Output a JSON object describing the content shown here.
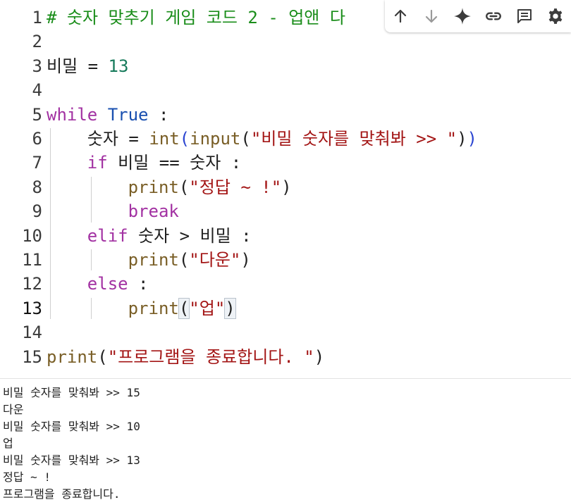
{
  "editor": {
    "active_line": 13,
    "lines": [
      {
        "n": "1",
        "tokens": [
          {
            "t": "# 숫자 맞추기 게임 코드 2 - 업앤 다",
            "c": "comment"
          }
        ]
      },
      {
        "n": "2",
        "tokens": []
      },
      {
        "n": "3",
        "tokens": [
          {
            "t": "비밀 = ",
            "c": "op"
          },
          {
            "t": "13",
            "c": "num"
          }
        ]
      },
      {
        "n": "4",
        "tokens": []
      },
      {
        "n": "5",
        "tokens": [
          {
            "t": "while",
            "c": "kw"
          },
          {
            "t": " ",
            "c": "op"
          },
          {
            "t": "True",
            "c": "bool"
          },
          {
            "t": " :",
            "c": "op"
          }
        ]
      },
      {
        "n": "6",
        "tokens": [
          {
            "t": "    숫자 = ",
            "c": "op"
          },
          {
            "t": "int",
            "c": "fn"
          },
          {
            "t": "(",
            "c": "paren2"
          },
          {
            "t": "input",
            "c": "fn"
          },
          {
            "t": "(",
            "c": "paren"
          },
          {
            "t": "\"비밀 숫자를 맞춰봐 >> \"",
            "c": "str"
          },
          {
            "t": ")",
            "c": "paren"
          },
          {
            "t": ")",
            "c": "paren2"
          }
        ]
      },
      {
        "n": "7",
        "tokens": [
          {
            "t": "    ",
            "c": "op"
          },
          {
            "t": "if",
            "c": "kw"
          },
          {
            "t": " 비밀 == 숫자 :",
            "c": "op"
          }
        ]
      },
      {
        "n": "8",
        "tokens": [
          {
            "t": "        ",
            "c": "op"
          },
          {
            "t": "print",
            "c": "fn"
          },
          {
            "t": "(",
            "c": "paren"
          },
          {
            "t": "\"정답 ~ !\"",
            "c": "str"
          },
          {
            "t": ")",
            "c": "paren"
          }
        ]
      },
      {
        "n": "9",
        "tokens": [
          {
            "t": "        ",
            "c": "op"
          },
          {
            "t": "break",
            "c": "kw"
          }
        ]
      },
      {
        "n": "10",
        "tokens": [
          {
            "t": "    ",
            "c": "op"
          },
          {
            "t": "elif",
            "c": "kw"
          },
          {
            "t": " 숫자 > 비밀 :",
            "c": "op"
          }
        ]
      },
      {
        "n": "11",
        "tokens": [
          {
            "t": "        ",
            "c": "op"
          },
          {
            "t": "print",
            "c": "fn"
          },
          {
            "t": "(",
            "c": "paren"
          },
          {
            "t": "\"다운\"",
            "c": "str"
          },
          {
            "t": ")",
            "c": "paren"
          }
        ]
      },
      {
        "n": "12",
        "tokens": [
          {
            "t": "    ",
            "c": "op"
          },
          {
            "t": "else",
            "c": "kw"
          },
          {
            "t": " :",
            "c": "op"
          }
        ]
      },
      {
        "n": "13",
        "tokens": [
          {
            "t": "        ",
            "c": "op"
          },
          {
            "t": "print",
            "c": "fn"
          },
          {
            "t": "(",
            "c": "paren",
            "match": true
          },
          {
            "t": "\"업\"",
            "c": "str"
          },
          {
            "t": ")",
            "c": "paren",
            "match": true
          }
        ]
      },
      {
        "n": "14",
        "tokens": []
      },
      {
        "n": "15",
        "tokens": [
          {
            "t": "print",
            "c": "fn"
          },
          {
            "t": "(",
            "c": "paren"
          },
          {
            "t": "\"프로그램을 종료합니다. \"",
            "c": "str"
          },
          {
            "t": ")",
            "c": "paren"
          }
        ]
      }
    ]
  },
  "toolbar": {
    "buttons": [
      {
        "name": "move-up-button",
        "icon": "arrow-up-icon",
        "color": "#3c3c3c"
      },
      {
        "name": "move-down-button",
        "icon": "arrow-down-icon",
        "color": "#9a9a9a"
      },
      {
        "name": "gemini-button",
        "icon": "sparkle-icon",
        "color": "#3c3c3c"
      },
      {
        "name": "copy-link-button",
        "icon": "link-icon",
        "color": "#3c3c3c"
      },
      {
        "name": "comment-button",
        "icon": "comment-icon",
        "color": "#3c3c3c"
      },
      {
        "name": "settings-button",
        "icon": "gear-icon",
        "color": "#3c3c3c"
      }
    ]
  },
  "output": {
    "lines": [
      "비밀 숫자를 맞춰봐 >> 15",
      "다운",
      "비밀 숫자를 맞춰봐 >> 10",
      "업",
      "비밀 숫자를 맞춰봐 >> 13",
      "정답 ~ !",
      "프로그램을 종료합니다."
    ]
  }
}
